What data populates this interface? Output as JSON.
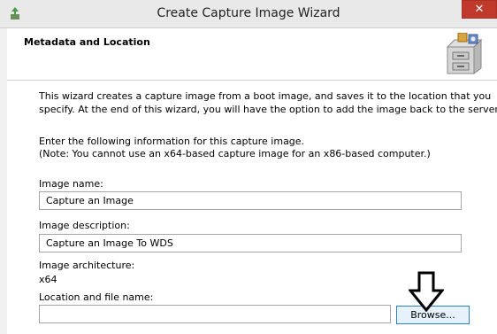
{
  "window": {
    "title": "Create Capture Image Wizard",
    "close_symbol": "✕"
  },
  "header": {
    "title": "Metadata and Location"
  },
  "intro": {
    "line1": "This wizard creates a capture image from a boot image, and saves it to the location that you",
    "line2": "specify. At the end of this wizard, you will have the option to add the image back to the server."
  },
  "instructions": {
    "line1": "Enter the following information for this capture image.",
    "line2": "(Note: You cannot use an x64-based capture image for an x86-based computer.)"
  },
  "image_name": {
    "label": "Image name:",
    "value": "Capture an Image"
  },
  "image_description": {
    "label": "Image description:",
    "value": "Capture an Image To WDS"
  },
  "architecture": {
    "label": "Image architecture:",
    "value": "x64"
  },
  "location": {
    "label": "Location and file name:",
    "value": ""
  },
  "browse_button": {
    "label": "Browse..."
  },
  "colors": {
    "titlebar": "#e9e9e9",
    "close": "#c0392b",
    "browse_border": "#2f7fd0"
  }
}
